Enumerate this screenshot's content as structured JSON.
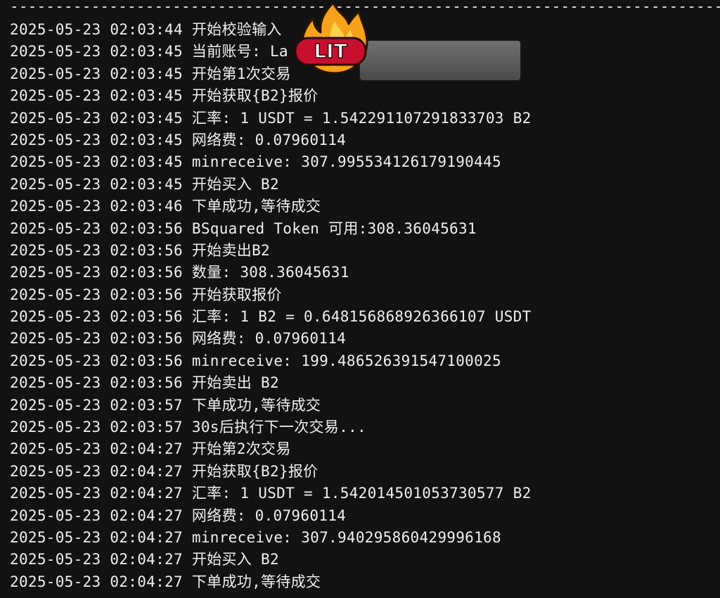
{
  "terminal": {
    "separator": "------------------------------------------------------------------------------------------------------------------------",
    "lines": [
      {
        "ts": "2025-05-23 02:03:44",
        "msg": "开始校验输入"
      },
      {
        "ts": "2025-05-23 02:03:45",
        "msg": "当前账号: La"
      },
      {
        "ts": "2025-05-23 02:03:45",
        "msg": "开始第1次交易"
      },
      {
        "ts": "2025-05-23 02:03:45",
        "msg": "开始获取{B2}报价"
      },
      {
        "ts": "2025-05-23 02:03:45",
        "msg": "汇率: 1 USDT = 1.542291107291833703 B2"
      },
      {
        "ts": "2025-05-23 02:03:45",
        "msg": "网络费: 0.07960114"
      },
      {
        "ts": "2025-05-23 02:03:45",
        "msg": "minreceive: 307.995534126179190445"
      },
      {
        "ts": "2025-05-23 02:03:45",
        "msg": "开始买入 B2"
      },
      {
        "ts": "2025-05-23 02:03:46",
        "msg": "下单成功,等待成交"
      },
      {
        "ts": "2025-05-23 02:03:56",
        "msg": "BSquared Token 可用:308.36045631"
      },
      {
        "ts": "2025-05-23 02:03:56",
        "msg": "开始卖出B2"
      },
      {
        "ts": "2025-05-23 02:03:56",
        "msg": "数量: 308.36045631"
      },
      {
        "ts": "2025-05-23 02:03:56",
        "msg": "开始获取报价"
      },
      {
        "ts": "2025-05-23 02:03:56",
        "msg": "汇率: 1 B2 = 0.648156868926366107 USDT"
      },
      {
        "ts": "2025-05-23 02:03:56",
        "msg": "网络费: 0.07960114"
      },
      {
        "ts": "2025-05-23 02:03:56",
        "msg": "minreceive: 199.486526391547100025"
      },
      {
        "ts": "2025-05-23 02:03:56",
        "msg": "开始卖出 B2"
      },
      {
        "ts": "2025-05-23 02:03:57",
        "msg": "下单成功,等待成交"
      },
      {
        "ts": "2025-05-23 02:03:57",
        "msg": "30s后执行下一次交易..."
      },
      {
        "ts": "2025-05-23 02:04:27",
        "msg": "开始第2次交易"
      },
      {
        "ts": "2025-05-23 02:04:27",
        "msg": "开始获取{B2}报价"
      },
      {
        "ts": "2025-05-23 02:04:27",
        "msg": "汇率: 1 USDT = 1.542014501053730577 B2"
      },
      {
        "ts": "2025-05-23 02:04:27",
        "msg": "网络费: 0.07960114"
      },
      {
        "ts": "2025-05-23 02:04:27",
        "msg": "minreceive: 307.940295860429996168"
      },
      {
        "ts": "2025-05-23 02:04:27",
        "msg": "开始买入 B2"
      },
      {
        "ts": "2025-05-23 02:04:27",
        "msg": "下单成功,等待成交"
      }
    ]
  },
  "sticker": {
    "text": "LIT",
    "icon": "fire-icon",
    "flame_color": "#f7a21b",
    "badge_color": "#c8102e"
  },
  "redaction": {
    "icon": "blurred-redaction"
  }
}
